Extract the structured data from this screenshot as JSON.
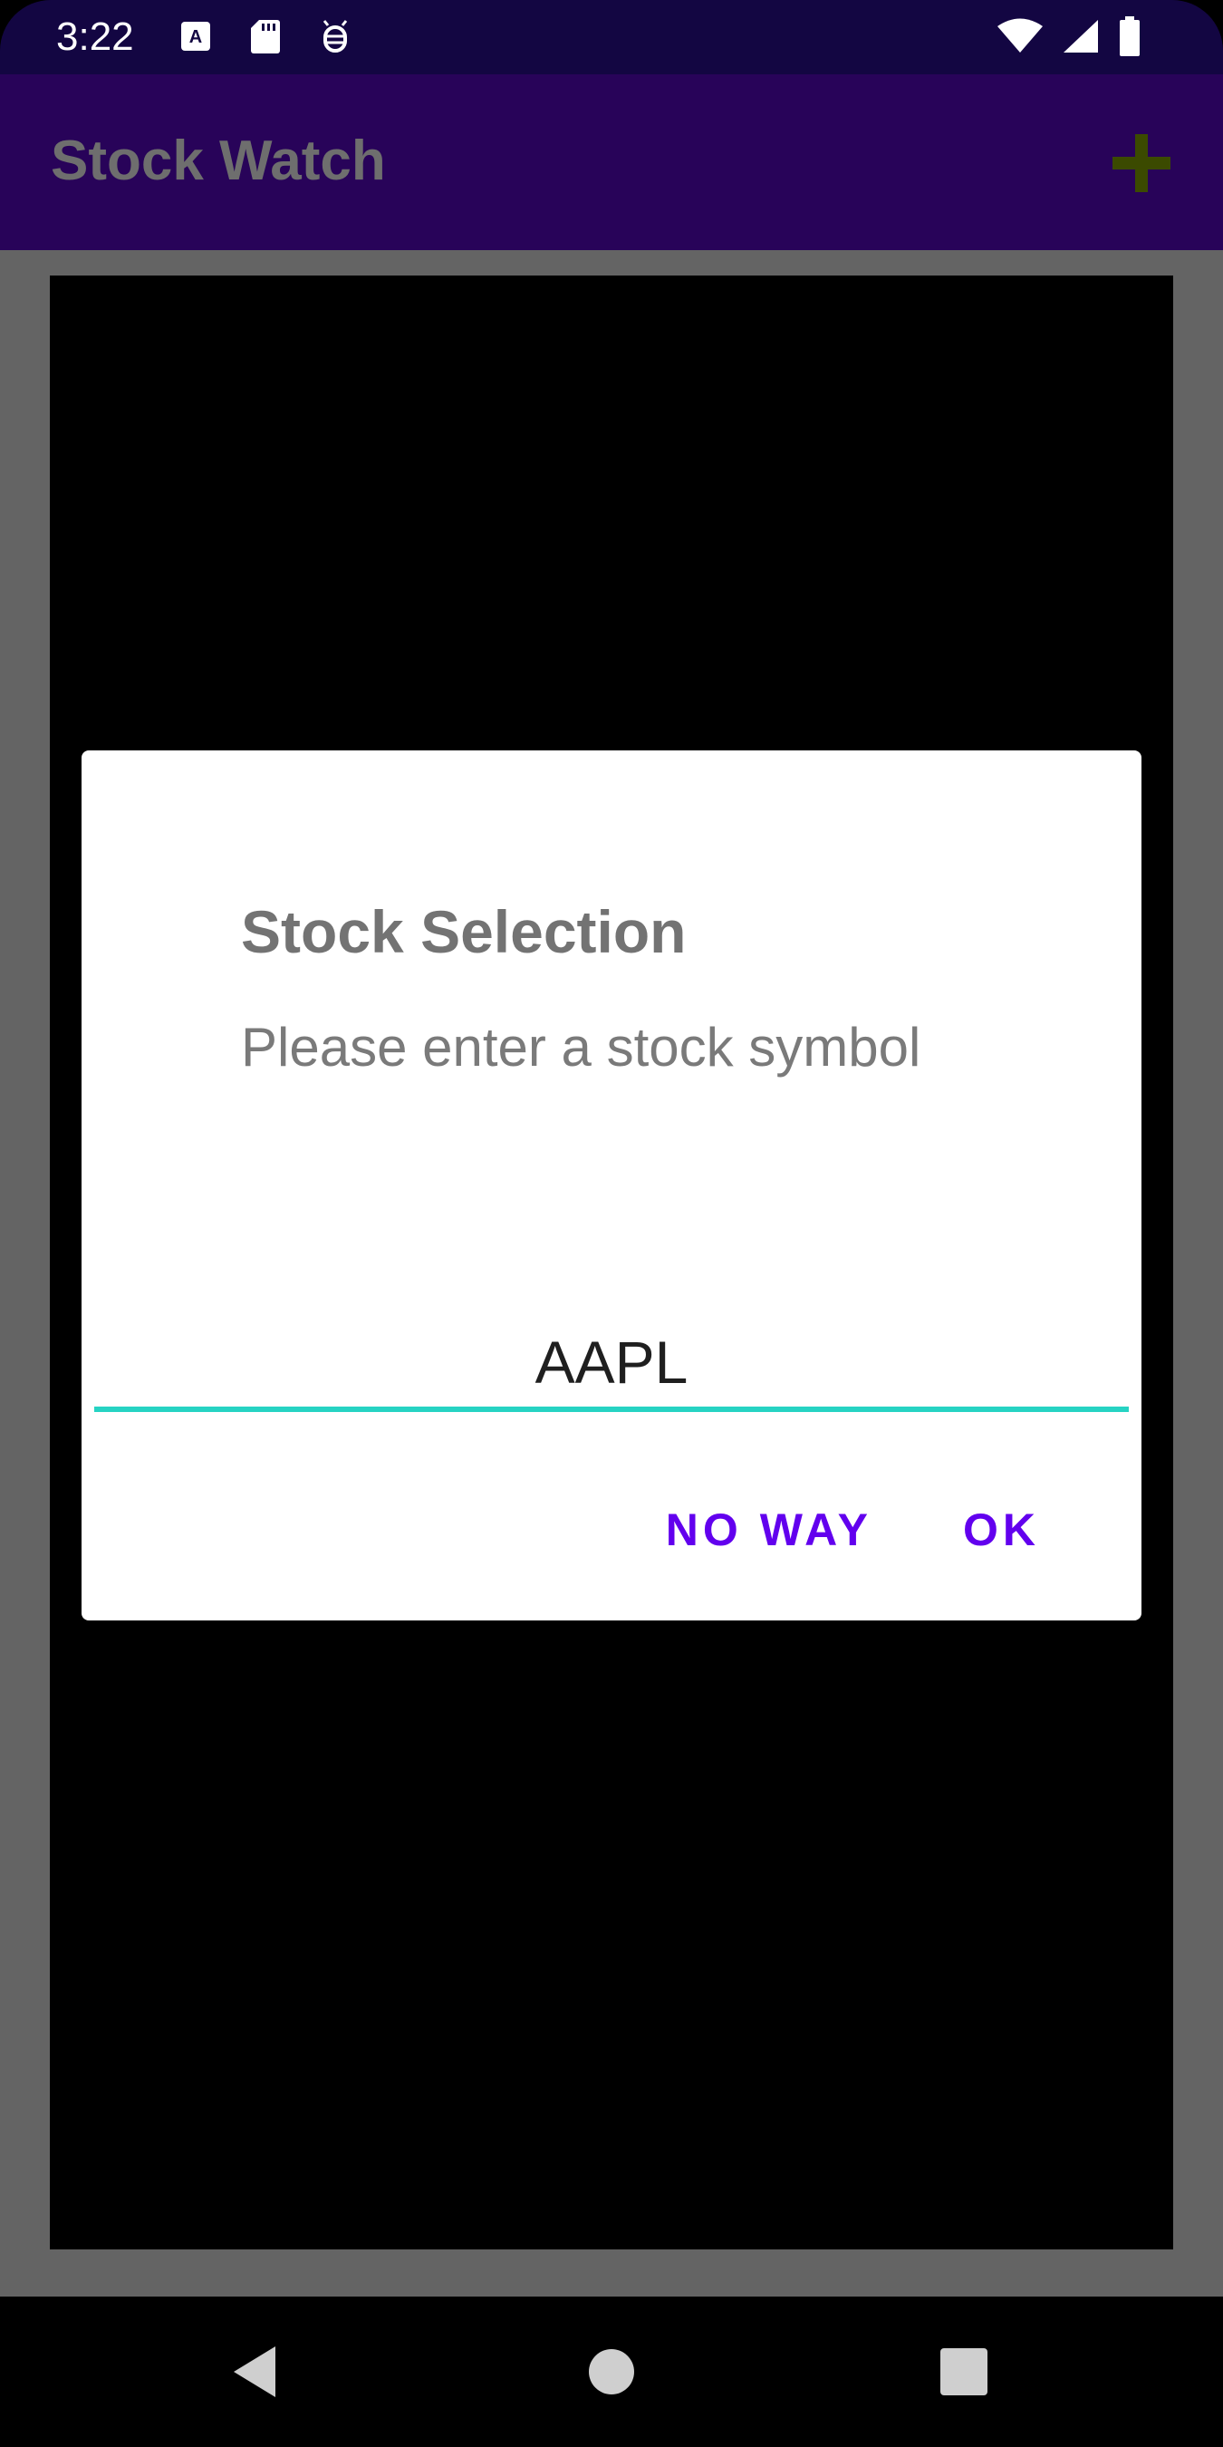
{
  "status_bar": {
    "time": "3:22",
    "icons": [
      "keyboard-a-icon",
      "sd-card-icon",
      "bug-icon",
      "wifi-icon",
      "cellular-signal-icon",
      "battery-icon"
    ]
  },
  "app_bar": {
    "title": "Stock Watch",
    "add_icon": "plus-icon",
    "add_icon_color": "#3b4a00"
  },
  "dialog": {
    "title": "Stock Selection",
    "message": "Please enter a stock symbol",
    "input_value": "AAPL",
    "negative_button": "NO WAY",
    "positive_button": "OK",
    "accent_color": "#6200ee",
    "underline_color": "#26d3c3"
  },
  "nav_bar": {
    "icons": [
      "back-icon",
      "home-icon",
      "recents-icon"
    ]
  },
  "colors": {
    "status_bar": "#130642",
    "app_bar": "#280359",
    "scrim": "#646464",
    "content": "#000000"
  }
}
